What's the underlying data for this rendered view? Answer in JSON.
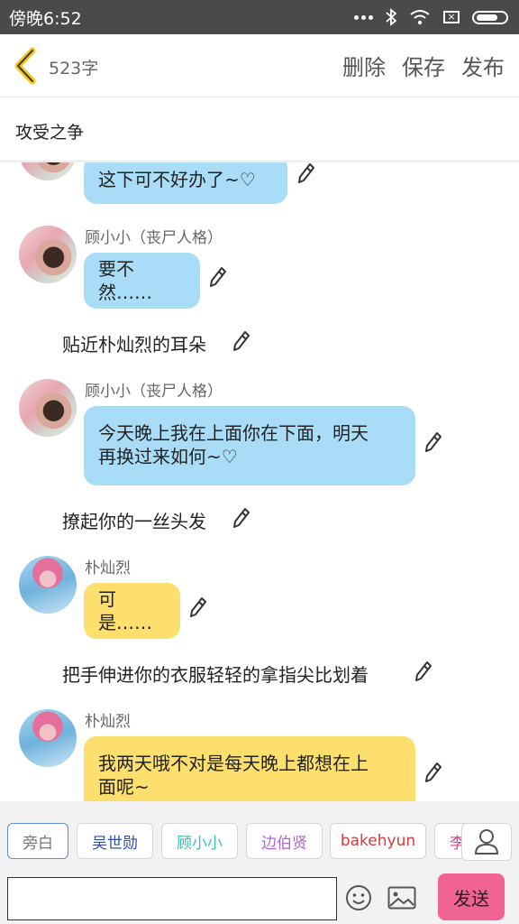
{
  "status_bar": {
    "time": "傍晚6:52"
  },
  "header": {
    "word_count": "523字",
    "actions": [
      "删除",
      "保存",
      "发布"
    ]
  },
  "story": {
    "title": "攻受之争"
  },
  "messages": [
    {
      "type": "bubble",
      "speaker": "",
      "lines": [
        "这下可不好办了~♡"
      ],
      "color": "#a9dcf7"
    },
    {
      "type": "bubble",
      "speaker": "顾小小（丧尸人格）",
      "lines": [
        "要不然……"
      ],
      "color": "#a9dcf7"
    },
    {
      "type": "narration",
      "text": "贴近朴灿烈的耳朵"
    },
    {
      "type": "bubble",
      "speaker": "顾小小（丧尸人格）",
      "lines": [
        "今天晚上我在上面你在下面，明天",
        "再换过来如何~♡"
      ],
      "color": "#a9dcf7"
    },
    {
      "type": "narration",
      "text": "撩起你的一丝头发"
    },
    {
      "type": "bubble",
      "speaker": "朴灿烈",
      "lines": [
        "可是……"
      ],
      "color": "#fddf6e"
    },
    {
      "type": "narration",
      "text": "把手伸进你的衣服轻轻的拿指尖比划着"
    },
    {
      "type": "bubble",
      "speaker": "朴灿烈",
      "lines": [
        "我两天哦不对是每天晚上都想在上",
        "面呢~"
      ],
      "color": "#fddf6e"
    }
  ],
  "roles": [
    {
      "label": "旁白",
      "color": "#777777",
      "selected": true
    },
    {
      "label": "吴世勋",
      "color": "#2b4fb0"
    },
    {
      "label": "顾小小",
      "color": "#3cc0b0"
    },
    {
      "label": "边伯贤",
      "color": "#b266d6"
    },
    {
      "label": "bakehyun",
      "color": "#d63a3a"
    },
    {
      "label": "李",
      "color": "#e0408a"
    }
  ],
  "composer": {
    "placeholder": "",
    "send_label": "发送"
  },
  "icons": {
    "back": "chevron-left-icon",
    "edit": "pencil-icon",
    "emoji": "smiley-icon",
    "image": "image-icon",
    "person": "person-icon"
  },
  "colors": {
    "bubble_blue": "#a9dcf7",
    "bubble_yellow": "#fddf6e",
    "send_button": "#f06394",
    "back_icon": "#f5c518"
  }
}
